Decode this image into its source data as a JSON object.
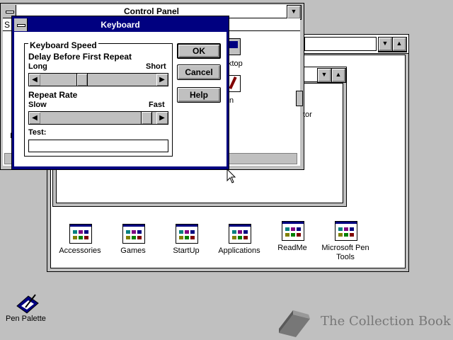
{
  "control_panel": {
    "title": "Control Panel",
    "partial_labels": [
      "S",
      "ktop",
      "n",
      "tor",
      "I"
    ]
  },
  "program_manager": {
    "groups": [
      {
        "label": "Accessories"
      },
      {
        "label": "Games"
      },
      {
        "label": "StartUp"
      },
      {
        "label": "Applications"
      },
      {
        "label": "ReadMe"
      },
      {
        "label": "Microsoft Pen",
        "label2": "Tools"
      }
    ]
  },
  "dialog": {
    "title": "Keyboard",
    "group_title": "Keyboard Speed",
    "delay_label": "Delay Before First Repeat",
    "delay_min": "Long",
    "delay_max": "Short",
    "delay_value": 0.35,
    "repeat_label": "Repeat Rate",
    "repeat_min": "Slow",
    "repeat_max": "Fast",
    "repeat_value": 0.97,
    "test_label": "Test:",
    "test_value": "",
    "ok_label": "OK",
    "cancel_label": "Cancel",
    "help_label": "Help"
  },
  "desktop": {
    "pen_palette_label": "Pen Palette",
    "watermark": "The Collection Book"
  },
  "colors": {
    "desktop": "#c0c0c0",
    "active_title": "#000080",
    "watermark": "#777777"
  }
}
